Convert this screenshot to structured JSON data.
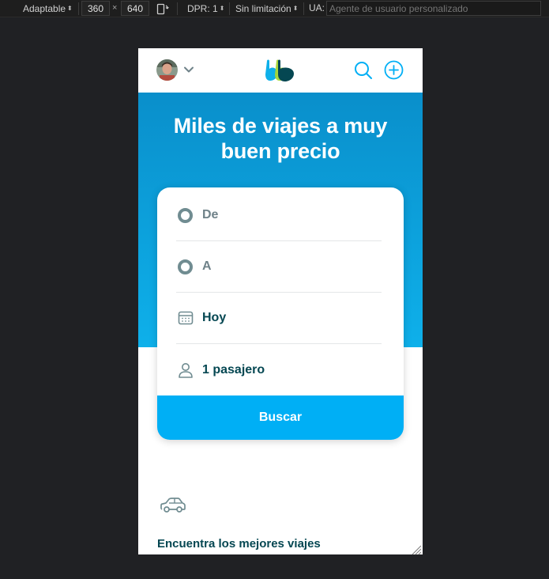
{
  "devtools": {
    "device_mode": "Adaptable",
    "width": "360",
    "times": "×",
    "height": "640",
    "dpr": "DPR: 1",
    "throttle": "Sin limitación",
    "ua_label": "UA:",
    "ua_placeholder": "Agente de usuario personalizado"
  },
  "nav": {
    "avatar_icon": "user-avatar",
    "logo_icon": "blablacar-logo",
    "brand_color": "#054752",
    "accent_color": "#00aff5"
  },
  "hero": {
    "title": "Miles de viajes a muy buen precio"
  },
  "search_form": {
    "from_placeholder": "De",
    "to_placeholder": "A",
    "date_value": "Hoy",
    "passengers_value": "1 pasajero",
    "submit_label": "Buscar"
  },
  "feature": {
    "icon": "car-icon",
    "title": "Encuentra los mejores viajes"
  }
}
